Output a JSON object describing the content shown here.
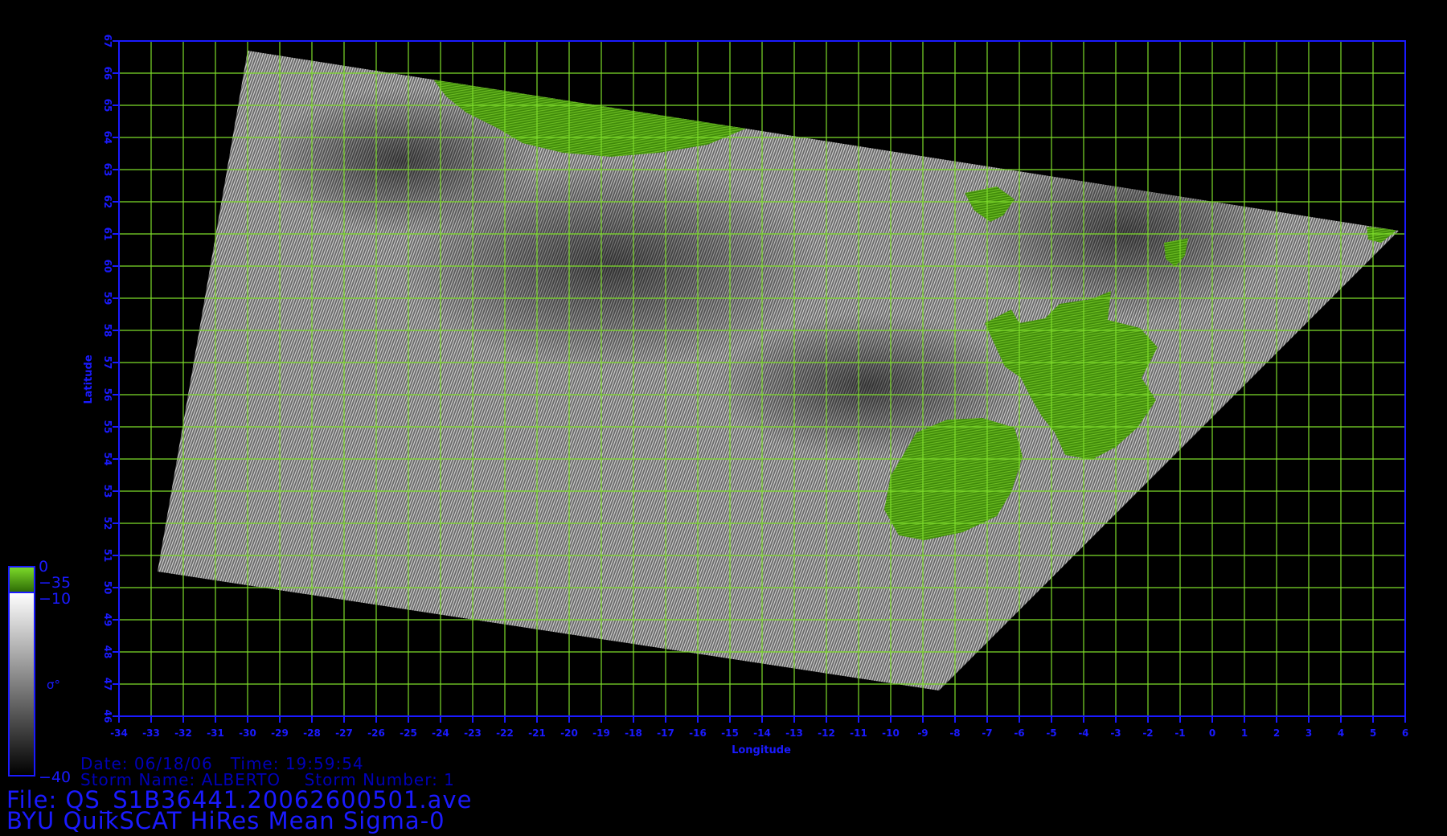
{
  "map": {
    "xlabel": "Longitude",
    "ylabel": "Latitude",
    "lon_ticks": [
      -34,
      -33,
      -32,
      -31,
      -30,
      -29,
      -28,
      -27,
      -26,
      -25,
      -24,
      -23,
      -22,
      -21,
      -20,
      -19,
      -18,
      -17,
      -16,
      -15,
      -14,
      -13,
      -12,
      -11,
      -10,
      -9,
      -8,
      -7,
      -6,
      -5,
      -4,
      -3,
      -2,
      -1,
      0,
      1,
      2,
      3,
      4,
      5,
      6
    ],
    "lat_ticks": [
      46,
      47,
      48,
      49,
      50,
      51,
      52,
      53,
      54,
      55,
      56,
      57,
      58,
      59,
      60,
      61,
      62,
      63,
      64,
      65,
      66,
      67
    ],
    "lon_range": [
      -34,
      6
    ],
    "lat_range": [
      46,
      67
    ],
    "swath_corners_lonlat": [
      [
        -30,
        66.7
      ],
      [
        5.8,
        61.1
      ],
      [
        -8.5,
        46.8
      ],
      [
        -32.8,
        50.5
      ]
    ],
    "colors": {
      "grid": "#7ddc2a",
      "axis": "#1a1aff",
      "land": "#4f9a10",
      "background": "#000000"
    }
  },
  "colorbar": {
    "label_top_land": "0",
    "label_land_low": "−35",
    "label_ocean_high": "−10",
    "label_symbol": "σ°",
    "label_bottom": "−40"
  },
  "info": {
    "line1": "Date: 06/18/06   Time: 19:59:54",
    "line2": "Storm Name: ALBERTO    Storm Number: 1",
    "file": "File: QS_S1B36441.20062600501.ave",
    "product": "BYU QuikSCAT HiRes Mean Sigma-0"
  }
}
